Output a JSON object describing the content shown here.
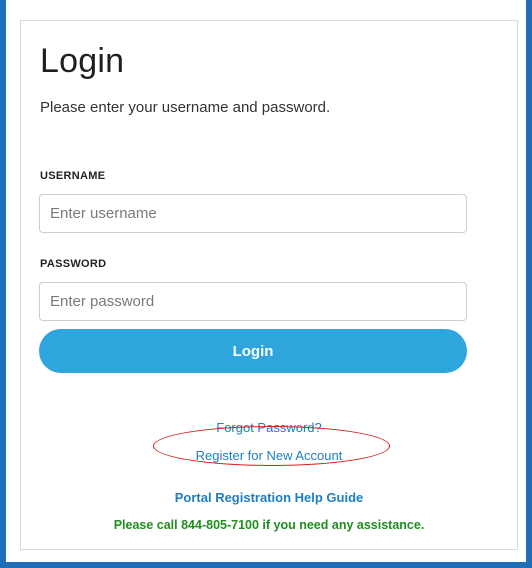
{
  "login": {
    "title": "Login",
    "subtitle": "Please enter your username and password.",
    "username": {
      "label": "USERNAME",
      "placeholder": "Enter username",
      "value": ""
    },
    "password": {
      "label": "PASSWORD",
      "placeholder": "Enter password",
      "value": ""
    },
    "submit_label": "Login",
    "forgot_password": "Forgot Password?",
    "register": "Register for New Account",
    "help_guide": "Portal Registration Help Guide",
    "assistance": "Please call 844-805-7100 if you need any assistance."
  },
  "colors": {
    "frame_border": "#1f6fb8",
    "button": "#2ea5dd",
    "link": "#1f7ec2",
    "assistance_text": "#1e8e1e",
    "highlight": "#d32020"
  }
}
